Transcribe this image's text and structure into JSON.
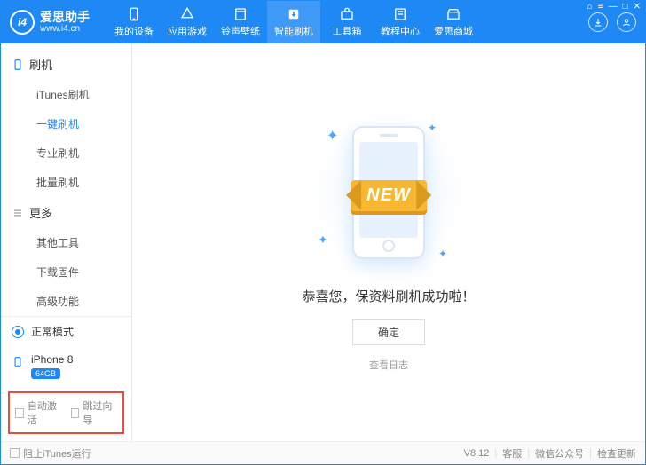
{
  "brand": {
    "title": "爱思助手",
    "url": "www.i4.cn",
    "logo_text": "i4"
  },
  "nav": [
    {
      "label": "我的设备"
    },
    {
      "label": "应用游戏"
    },
    {
      "label": "铃声壁纸"
    },
    {
      "label": "智能刷机",
      "active": true
    },
    {
      "label": "工具箱"
    },
    {
      "label": "教程中心"
    },
    {
      "label": "爱思商城"
    }
  ],
  "sidebar": {
    "group1": {
      "title": "刷机",
      "items": [
        "iTunes刷机",
        "一键刷机",
        "专业刷机",
        "批量刷机"
      ],
      "active_index": 1
    },
    "group2": {
      "title": "更多",
      "items": [
        "其他工具",
        "下载固件",
        "高级功能"
      ]
    },
    "mode": "正常模式",
    "device": {
      "name": "iPhone 8",
      "storage": "64GB"
    },
    "checks": {
      "auto_activate": "自动激活",
      "skip_guide": "跳过向导"
    }
  },
  "main": {
    "ribbon": "NEW",
    "message": "恭喜您，保资料刷机成功啦！",
    "ok": "确定",
    "view_log": "查看日志"
  },
  "footer": {
    "block_itunes": "阻止iTunes运行",
    "version": "V8.12",
    "support": "客服",
    "wechat": "微信公众号",
    "update": "检查更新"
  }
}
